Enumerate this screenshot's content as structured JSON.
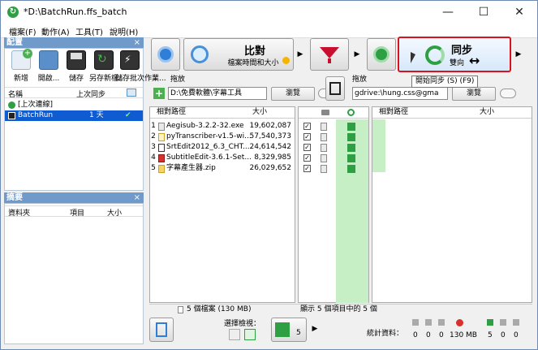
{
  "window": {
    "title": "*D:\\BatchRun.ffs_batch",
    "minimize": "—",
    "maximize": "☐",
    "close": "✕"
  },
  "menu": [
    "檔案(F)",
    "動作(A)",
    "工具(T)",
    "說明(H)"
  ],
  "config_panel": {
    "header": "配置",
    "close": "×",
    "tools": [
      {
        "label": "新增",
        "icon": "new-config-icon"
      },
      {
        "label": "開啟...",
        "icon": "open-icon"
      },
      {
        "label": "儲存",
        "icon": "save-icon"
      },
      {
        "label": "另存新檔...",
        "icon": "save-as-icon"
      },
      {
        "label": "儲存批次作業...",
        "icon": "batch-save-icon"
      }
    ],
    "columns": {
      "name": "名稱",
      "last_sync": "上次同步"
    },
    "items": [
      {
        "name": "[上次連線]",
        "last_sync": "",
        "selected": false
      },
      {
        "name": "BatchRun",
        "last_sync": "1 天",
        "selected": true,
        "check": "✔"
      }
    ]
  },
  "summary_panel": {
    "header": "摘要",
    "close": "×",
    "columns": {
      "folder": "資料夾",
      "items": "項目",
      "size": "大小"
    }
  },
  "toolbar": {
    "compare": {
      "title": "比對",
      "subtitle": "檔案時間和大小"
    },
    "sync": {
      "title": "同步",
      "subtitle": "雙向",
      "mode_symbol": "↔"
    },
    "tooltip": "開始同步 (S) (F9)",
    "accent_border": "#d9121d"
  },
  "left_folder": {
    "label": "拖放",
    "path": "D:\\免費軟體\\字幕工具",
    "browse": "瀏覽"
  },
  "right_folder": {
    "label": "拖放",
    "path": "gdrive:\\hung.css@gma",
    "browse": "瀏覽"
  },
  "left_grid": {
    "columns": {
      "path": "相對路徑",
      "size": "大小"
    },
    "rows": [
      {
        "num": "1",
        "name": "Aegisub-3.2.2-32.exe",
        "size": "19,602,087"
      },
      {
        "num": "2",
        "name": "pyTranscriber-v1.5-wi...",
        "size": "57,540,373"
      },
      {
        "num": "3",
        "name": "SrtEdit2012_6.3_CHT....",
        "size": "24,614,542"
      },
      {
        "num": "4",
        "name": "SubtitleEdit-3.6.1-Set...",
        "size": "8,329,985"
      },
      {
        "num": "5",
        "name": "字幕產生器.zip",
        "size": "26,029,652"
      }
    ]
  },
  "right_grid": {
    "columns": {
      "path": "相對路徑",
      "size": "大小"
    }
  },
  "status": {
    "left": "5 個檔案 (130 MB)",
    "middle": "顯示 5 個項目中的 5 個"
  },
  "bottom": {
    "view_label": "選擇檢視：",
    "sync_count": "5",
    "stats_label": "統計資料：",
    "stats": [
      "0",
      "0",
      "0",
      "130 MB",
      "5",
      "0",
      "0"
    ]
  }
}
